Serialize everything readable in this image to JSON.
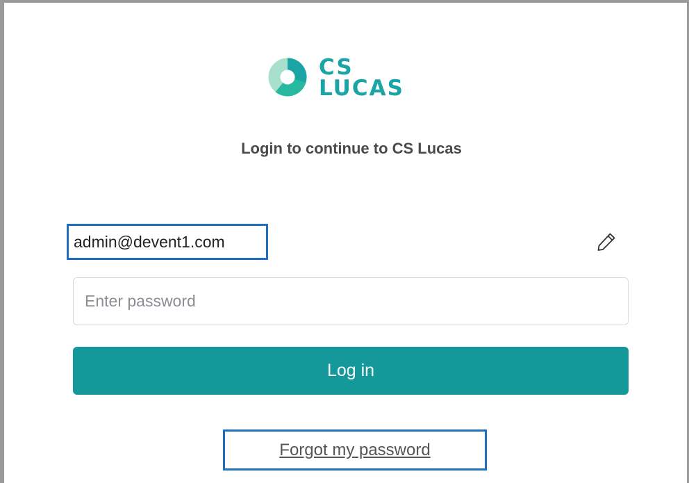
{
  "brand": {
    "line1": "CS",
    "line2": "LUCAS",
    "accent_color": "#1aa4a6",
    "mark_icon": "donut-logo-icon"
  },
  "login": {
    "subtitle": "Login to continue to CS Lucas",
    "email": "admin@devent1.com",
    "edit_icon": "pencil-icon",
    "password_placeholder": "Enter password",
    "password_value": "",
    "submit_label": "Log in",
    "submit_color": "#14989a",
    "forgot_label": "Forgot my password",
    "highlight_color": "#1d6fbe"
  }
}
